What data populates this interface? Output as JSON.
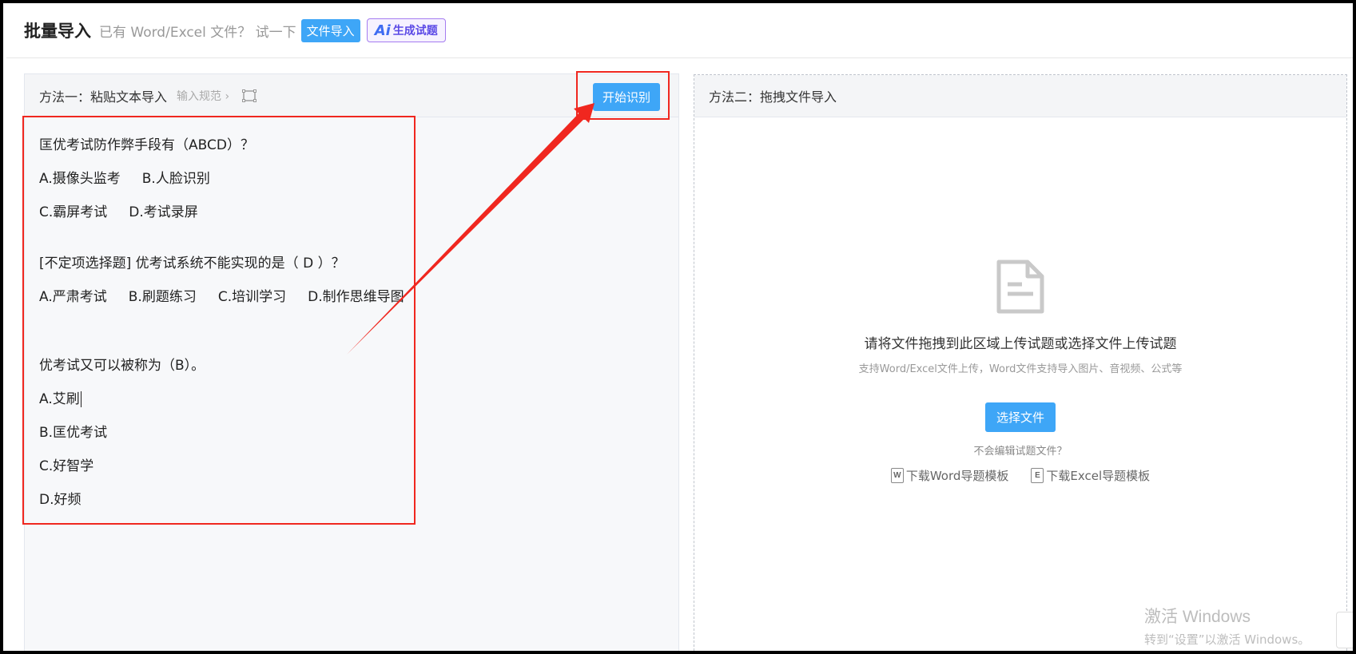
{
  "topbar": {
    "title": "批量导入",
    "hint": "已有 Word/Excel 文件？ 试一下",
    "file_import_label": "文件导入",
    "ai_mark": "Ai",
    "ai_label": "生成试题"
  },
  "left_panel": {
    "title": "方法一：粘贴文本导入",
    "rules_label": "输入规范 ›",
    "start_button": "开始识别",
    "lines": [
      "匡优考试防作弊手段有（ABCD）？",
      "A.摄像头监考     B.人脸识别",
      "C.霸屏考试     D.考试录屏",
      "",
      "[不定项选择题] 优考试系统不能实现的是（ D ）？",
      "A.严肃考试     B.刷题练习     C.培训学习     D.制作思维导图",
      "",
      "",
      "优考试又可以被称为（B）。",
      "A.艾刷",
      "B.匡优考试",
      "C.好智学",
      "D.好频"
    ]
  },
  "right_panel": {
    "title": "方法二：拖拽文件导入",
    "main_tip": "请将文件拖拽到此区域上传试题或选择文件上传试题",
    "sub_tip": "支持Word/Excel文件上传，Word文件支持导入图片、音视频、公式等",
    "choose_button": "选择文件",
    "no_edit_tip": "不会编辑试题文件？",
    "word_template": "下载Word导题模板",
    "excel_template": "下载Excel导题模板",
    "word_icon_letter": "W",
    "excel_icon_letter": "E"
  },
  "watermark": {
    "line1": "激活 Windows",
    "line2": "转到“设置”以激活 Windows。"
  },
  "colors": {
    "accent": "#3ea6f7",
    "annotation": "#f0271f"
  }
}
